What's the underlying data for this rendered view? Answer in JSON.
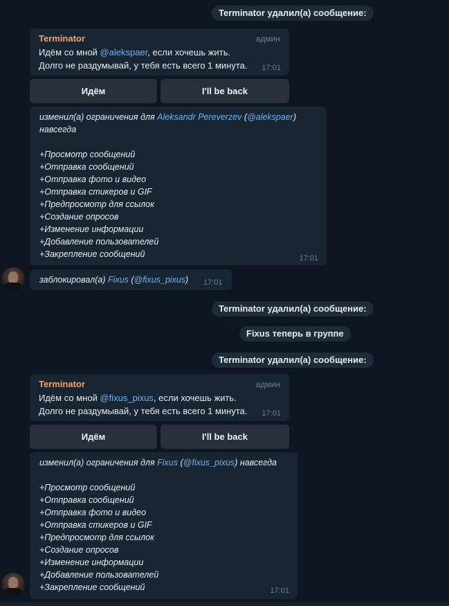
{
  "chat": {
    "service_deleted": "Terminator удалил(а) сообщение:",
    "service_joined": "Fixus теперь в группе",
    "bot_message_1": {
      "sender": "Terminator",
      "role": "админ",
      "line1_prefix": "Идём со мной ",
      "mention": "@alekspaer",
      "line1_suffix": ", если хочешь жить.",
      "line2": "Долго не раздумывай, у тебя есть всего 1 минута.",
      "time": "17:01"
    },
    "bot_message_2": {
      "sender": "Terminator",
      "role": "админ",
      "line1_prefix": "Идём со мной ",
      "mention": "@fixus_pixus",
      "line1_suffix": ", если хочешь жить.",
      "line2": "Долго не раздумывай, у тебя есть всего 1 минута.",
      "time": "17:01"
    },
    "buttons": {
      "go": "Идём",
      "back": "I'll be back"
    },
    "restrictions_1": {
      "prefix": "изменил(а) ограничения для ",
      "name": "Aleksandr Pereverzev",
      "open_paren": " (",
      "username": "@alekspaer",
      "close_paren": ")",
      "forever": "навсегда",
      "items": [
        "+Просмотр сообщений",
        "+Отправка сообщений",
        "+Отправка фото и видео",
        "+Отправка стикеров и GIF",
        "+Предпросмотр для ссылок",
        "+Создание опросов",
        "+Изменение информации",
        "+Добавление пользователей",
        "+Закрепление сообщений"
      ],
      "time": "17:01"
    },
    "ban": {
      "prefix": "заблокировал(а) ",
      "name": "Fixus",
      "open_paren": " (",
      "username": "@fixus_pixus",
      "close_paren": ")",
      "time": "17:01"
    },
    "restrictions_2": {
      "prefix": "изменил(а) ограничения для ",
      "name": "Fixus",
      "open_paren": " (",
      "username": "@fixus_pixus",
      "close_paren": ") навсегда",
      "items": [
        "+Просмотр сообщений",
        "+Отправка сообщений",
        "+Отправка фото и видео",
        "+Отправка стикеров и GIF",
        "+Предпросмотр для ссылок",
        "+Создание опросов",
        "+Изменение информации",
        "+Добавление пользователей",
        "+Закрепление сообщений"
      ],
      "time": "17:01"
    },
    "icons": {
      "avatar": "terminator-avatar-icon"
    },
    "colors": {
      "background": "#0e1621",
      "bubble": "#182533",
      "sender": "#f5a25c",
      "link": "#6ab3f3",
      "button": "#28313b"
    }
  }
}
